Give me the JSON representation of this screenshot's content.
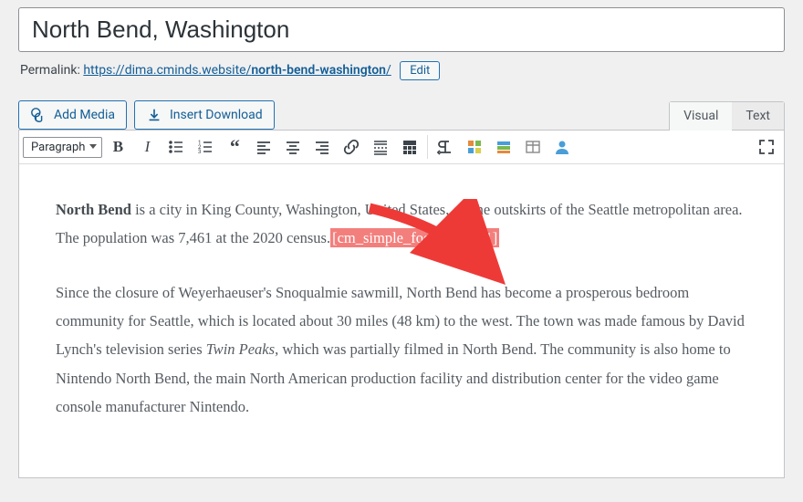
{
  "title": "North Bend, Washington",
  "permalink": {
    "label": "Permalink:",
    "base": "https://dima.cminds.website/",
    "slug": "north-bend-washington",
    "trail": "/",
    "edit": "Edit"
  },
  "buttons": {
    "add_media": "Add Media",
    "insert_download": "Insert Download"
  },
  "tabs": {
    "visual": "Visual",
    "text": "Text"
  },
  "toolbar": {
    "format": "Paragraph"
  },
  "body": {
    "p1_strong": "North Bend",
    "p1_a": " is a city in King County, Washington, United States, on the outskirts of the Seattle metropolitan area. The population was 7,461 at the 2020 census.",
    "p1_shortcode": "[cm_simple_footnote id=1]",
    "p2_a": "Since the closure of Weyerhaeuser's Snoqualmie sawmill, North Bend has become a prosperous bedroom community for Seattle, which is located about 30 miles (48 km) to the west. The town was made famous by David Lynch's television series ",
    "p2_em": "Twin Peaks",
    "p2_b": ", which was partially filmed in North Bend. The community is also home to Nintendo North Bend, the main North American production facility and distribution center for the video game console manufacturer Nintendo."
  }
}
